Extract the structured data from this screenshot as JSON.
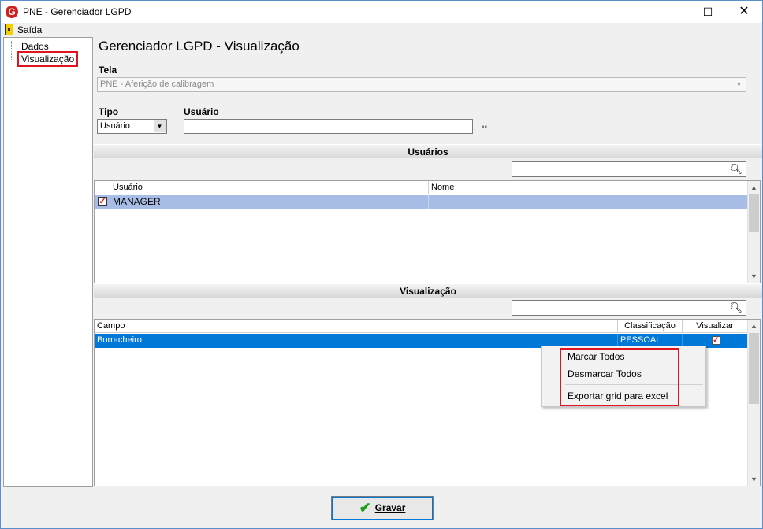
{
  "window": {
    "title": "PNE - Gerenciador LGPD",
    "app_icon_letter": "G",
    "controls": {
      "minimize": "—",
      "maximize": "☐",
      "close": "✕"
    }
  },
  "menu": {
    "exit_label": "Saída"
  },
  "nav": {
    "items": [
      {
        "label": "Dados"
      },
      {
        "label": "Visualização",
        "selected": true
      }
    ]
  },
  "page": {
    "title": "Gerenciador LGPD - Visualização"
  },
  "form": {
    "tela_label": "Tela",
    "tela_value": "PNE - Aferição de calibragem",
    "tipo_label": "Tipo",
    "tipo_value": "Usuário",
    "usuario_label": "Usuário",
    "usuario_value": ""
  },
  "usuarios": {
    "header": "Usuários",
    "search_value": "",
    "columns": [
      "Usuário",
      "Nome"
    ],
    "rows": [
      {
        "checked": true,
        "usuario": "MANAGER",
        "nome": ""
      }
    ]
  },
  "visualizacao": {
    "header": "Visualização",
    "search_value": "",
    "columns": [
      "Campo",
      "Classificação",
      "Visualizar"
    ],
    "rows": [
      {
        "campo": "Borracheiro",
        "classificacao": "PESSOAL",
        "visualizar": true
      }
    ]
  },
  "context_menu": {
    "items": [
      "Marcar Todos",
      "Desmarcar Todos",
      "Exportar grid para excel"
    ]
  },
  "footer": {
    "save_label": "Gravar"
  },
  "colors": {
    "accent": "#0078d7",
    "highlight_box": "#e0141e",
    "selected_row": "#a7bde6"
  }
}
